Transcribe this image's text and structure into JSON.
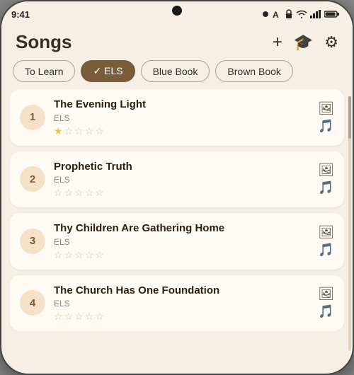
{
  "statusBar": {
    "time": "9:41",
    "icons": [
      "notification-dot",
      "vpn-icon",
      "location-icon",
      "wifi-icon",
      "signal-icon",
      "battery-icon"
    ]
  },
  "header": {
    "title": "Songs",
    "addLabel": "+",
    "graduationIcon": "🎓",
    "settingsIcon": "⚙"
  },
  "filters": [
    {
      "label": "To Learn",
      "active": false
    },
    {
      "label": "ELS",
      "active": true
    },
    {
      "label": "Blue Book",
      "active": false
    },
    {
      "label": "Brown Book",
      "active": false
    }
  ],
  "songs": [
    {
      "number": "1",
      "title": "The Evening Light",
      "subtitle": "ELS",
      "stars": [
        true,
        false,
        false,
        false,
        false
      ]
    },
    {
      "number": "2",
      "title": "Prophetic Truth",
      "subtitle": "ELS",
      "stars": [
        false,
        false,
        false,
        false,
        false
      ]
    },
    {
      "number": "3",
      "title": "Thy Children Are Gathering Home",
      "subtitle": "ELS",
      "stars": [
        false,
        false,
        false,
        false,
        false
      ]
    },
    {
      "number": "4",
      "title": "The Church Has One Foundation",
      "subtitle": "ELS",
      "stars": [
        false,
        false,
        false,
        false,
        false
      ]
    }
  ]
}
